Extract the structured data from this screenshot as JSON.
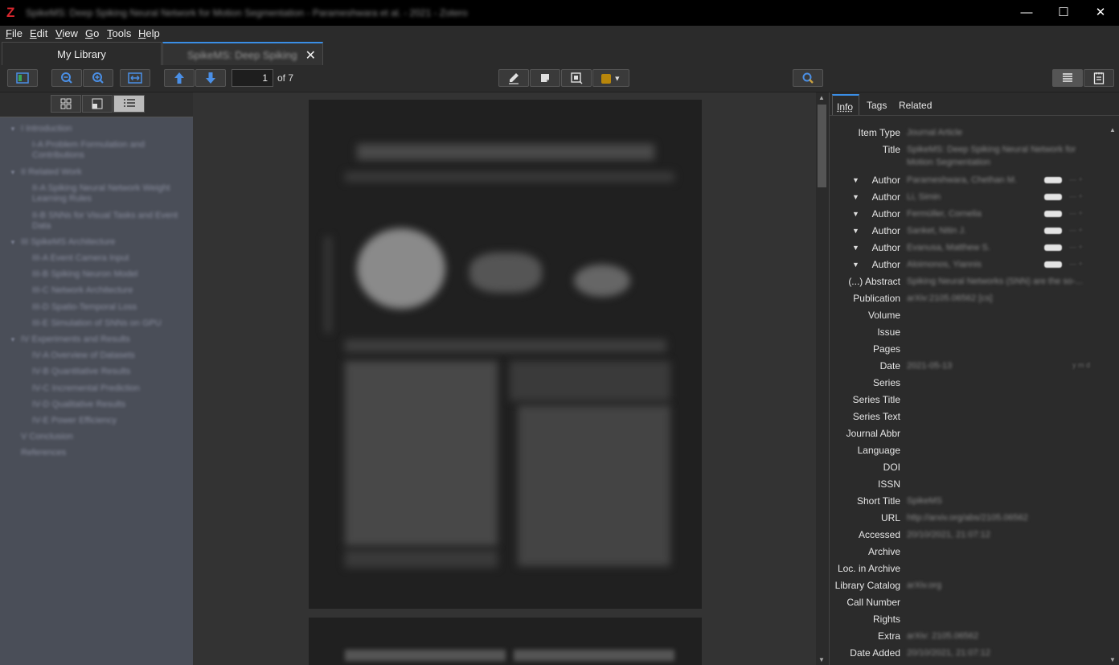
{
  "window": {
    "logo": "Z",
    "title": "SpikeMS: Deep Spiking Neural Network for Motion Segmentation - Parameshwara et al. - 2021 - Zotero",
    "minimize": "—",
    "maximize": "☐",
    "close": "✕"
  },
  "menu": [
    {
      "label": "File",
      "u": "F",
      "rest": "ile"
    },
    {
      "label": "Edit",
      "u": "E",
      "rest": "dit"
    },
    {
      "label": "View",
      "u": "V",
      "rest": "iew"
    },
    {
      "label": "Go",
      "u": "G",
      "rest": "o"
    },
    {
      "label": "Tools",
      "u": "T",
      "rest": "ools"
    },
    {
      "label": "Help",
      "u": "H",
      "rest": "elp"
    }
  ],
  "tabs": {
    "library": "My Library",
    "document": "SpikeMS: Deep Spiking ...",
    "close": "✕"
  },
  "toolbar": {
    "page_number": "1",
    "page_of": "of 7",
    "highlight_color": "#b8860b"
  },
  "outline": [
    {
      "label": "I Introduction",
      "level": 0
    },
    {
      "label": "I-A Problem Formulation and Contributions",
      "level": 1
    },
    {
      "label": "II Related Work",
      "level": 0
    },
    {
      "label": "II-A Spiking Neural Network Weight Learning Rules",
      "level": 1
    },
    {
      "label": "II-B SNNs for Visual Tasks and Event Data",
      "level": 1
    },
    {
      "label": "III SpikeMS Architecture",
      "level": 0
    },
    {
      "label": "III-A Event Camera Input",
      "level": 1
    },
    {
      "label": "III-B Spiking Neuron Model",
      "level": 1
    },
    {
      "label": "III-C Network Architecture",
      "level": 1
    },
    {
      "label": "III-D Spatio-Temporal Loss",
      "level": 1
    },
    {
      "label": "III-E Simulation of SNNs on GPU",
      "level": 1
    },
    {
      "label": "IV Experiments and Results",
      "level": 0
    },
    {
      "label": "IV-A Overview of Datasets",
      "level": 1
    },
    {
      "label": "IV-B Quantitative Results",
      "level": 1
    },
    {
      "label": "IV-C Incremental Prediction",
      "level": 1
    },
    {
      "label": "IV-D Qualitative Results",
      "level": 1
    },
    {
      "label": "IV-E Power Efficiency",
      "level": 1
    },
    {
      "label": "V Conclusion",
      "level": 0
    },
    {
      "label": "References",
      "level": 0
    }
  ],
  "right_tabs": [
    "Info",
    "Tags",
    "Related"
  ],
  "fields": [
    {
      "label": "Item Type",
      "value": "Journal Article"
    },
    {
      "label": "Title",
      "value": "SpikeMS: Deep Spiking Neural Network for",
      "value2": "Motion Segmentation"
    },
    {
      "label": "Author",
      "value": "Parameshwara, Chethan M.",
      "author": true
    },
    {
      "label": "Author",
      "value": "Li, Simin",
      "author": true
    },
    {
      "label": "Author",
      "value": "Fermüller, Cornelia",
      "author": true
    },
    {
      "label": "Author",
      "value": "Sanket, Nitin J.",
      "author": true
    },
    {
      "label": "Author",
      "value": "Evanusa, Matthew S.",
      "author": true
    },
    {
      "label": "Author",
      "value": "Aloimonos, Yiannis",
      "author": true
    },
    {
      "label": "(...) Abstract",
      "value": "Spiking Neural Networks (SNN) are the so-..."
    },
    {
      "label": "Publication",
      "value": "arXiv:2105.06562 [cs]"
    },
    {
      "label": "Volume",
      "value": ""
    },
    {
      "label": "Issue",
      "value": ""
    },
    {
      "label": "Pages",
      "value": ""
    },
    {
      "label": "Date",
      "value": "2021-05-13"
    },
    {
      "label": "Series",
      "value": ""
    },
    {
      "label": "Series Title",
      "value": ""
    },
    {
      "label": "Series Text",
      "value": ""
    },
    {
      "label": "Journal Abbr",
      "value": ""
    },
    {
      "label": "Language",
      "value": ""
    },
    {
      "label": "DOI",
      "value": ""
    },
    {
      "label": "ISSN",
      "value": ""
    },
    {
      "label": "Short Title",
      "value": "SpikeMS"
    },
    {
      "label": "URL",
      "value": "http://arxiv.org/abs/2105.06562"
    },
    {
      "label": "Accessed",
      "value": "20/10/2021, 21:07:12"
    },
    {
      "label": "Archive",
      "value": ""
    },
    {
      "label": "Loc. in Archive",
      "value": ""
    },
    {
      "label": "Library Catalog",
      "value": "arXiv.org"
    },
    {
      "label": "Call Number",
      "value": ""
    },
    {
      "label": "Rights",
      "value": ""
    },
    {
      "label": "Extra",
      "value": "arXiv: 2105.06562"
    },
    {
      "label": "Date Added",
      "value": "20/10/2021, 21:07:12"
    }
  ],
  "date_hint": "y m d"
}
